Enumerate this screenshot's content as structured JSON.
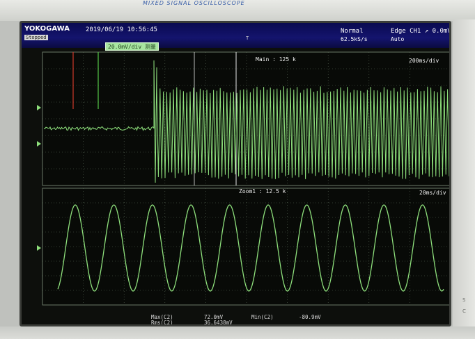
{
  "device": {
    "brand_text": "MIXED SIGNAL OSCILLOSCOPE",
    "logo": "YOKOGAWA",
    "run_state": "Stopped"
  },
  "status": {
    "datetime": "2019/06/19 10:56:45",
    "acq_mode": "Normal",
    "sample_rate": "62.5kS/s",
    "trigger_source": "Edge CH1",
    "trigger_level": "0.0mV",
    "trigger_mode": "Auto",
    "trigger_marker": "T"
  },
  "cursor": {
    "readout": "20.0mV/div 测量"
  },
  "main_panel": {
    "title": "Main : 125 k",
    "timebase": "200ms/div"
  },
  "zoom_panel": {
    "title": "Zoom1 : 12.5 k",
    "timebase": "20ms/div",
    "cycles": 10
  },
  "measurements": {
    "max_label": "Max(C2)",
    "rms_label": "Rms(C2)",
    "max_value": "72.0mV",
    "rms_value": "36.6438mV",
    "min_label": "Min(C2)",
    "min_value": "-80.9mV"
  },
  "colors": {
    "trace": "#8ee07c",
    "grid": "#5b6a58",
    "cursor_red": "#d23a2a",
    "cursor_green": "#56c84a",
    "cursor_white": "#e8e8e8"
  }
}
